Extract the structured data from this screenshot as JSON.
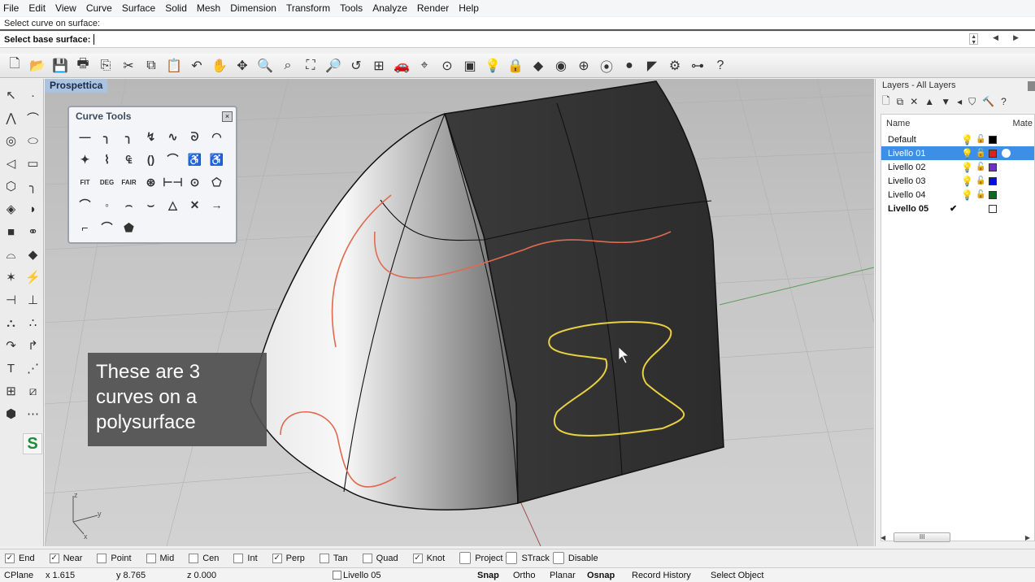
{
  "menu": [
    "File",
    "Edit",
    "View",
    "Curve",
    "Surface",
    "Solid",
    "Mesh",
    "Dimension",
    "Transform",
    "Tools",
    "Analyze",
    "Render",
    "Help"
  ],
  "command": {
    "history": "Select curve on surface:",
    "prompt": "Select base surface:"
  },
  "toolbar": {
    "icons": [
      {
        "name": "new-icon",
        "glyph": "🗋"
      },
      {
        "name": "open-icon",
        "glyph": "📂"
      },
      {
        "name": "save-icon",
        "glyph": "💾"
      },
      {
        "name": "print-icon",
        "glyph": "🖶"
      },
      {
        "name": "export-icon",
        "glyph": "⎘"
      },
      {
        "name": "cut-icon",
        "glyph": "✂"
      },
      {
        "name": "copy-icon",
        "glyph": "⧉"
      },
      {
        "name": "paste-icon",
        "glyph": "📋"
      },
      {
        "name": "undo-icon",
        "glyph": "↶"
      },
      {
        "name": "pan-icon",
        "glyph": "✋"
      },
      {
        "name": "rotate-view-icon",
        "glyph": "✥"
      },
      {
        "name": "zoom-icon",
        "glyph": "🔍"
      },
      {
        "name": "zoom-window-icon",
        "glyph": "⌕"
      },
      {
        "name": "zoom-extents-icon",
        "glyph": "⛶"
      },
      {
        "name": "zoom-selected-icon",
        "glyph": "🔎"
      },
      {
        "name": "undo-view-icon",
        "glyph": "↺"
      },
      {
        "name": "four-viewports-icon",
        "glyph": "⊞"
      },
      {
        "name": "car-icon",
        "glyph": "🚗"
      },
      {
        "name": "grid-snap-icon",
        "glyph": "⌖"
      },
      {
        "name": "point-filter-icon",
        "glyph": "⊙"
      },
      {
        "name": "select-objects-icon",
        "glyph": "▣"
      },
      {
        "name": "light-bulb-icon",
        "glyph": "💡"
      },
      {
        "name": "lock-icon",
        "glyph": "🔒"
      },
      {
        "name": "layer-icon",
        "glyph": "◆"
      },
      {
        "name": "color-wheel-icon",
        "glyph": "◉"
      },
      {
        "name": "wireframe-sphere-icon",
        "glyph": "⊕"
      },
      {
        "name": "shaded-sphere-icon",
        "glyph": "⦿"
      },
      {
        "name": "rendered-sphere-icon",
        "glyph": "●"
      },
      {
        "name": "render-flag-icon",
        "glyph": "◤"
      },
      {
        "name": "options-gear-icon",
        "glyph": "⚙"
      },
      {
        "name": "hierarchy-icon",
        "glyph": "⊶"
      },
      {
        "name": "help-icon",
        "glyph": "?"
      }
    ]
  },
  "left_tools": [
    {
      "name": "select-arrow-icon",
      "glyph": "↖"
    },
    {
      "name": "point-icon",
      "glyph": "·"
    },
    {
      "name": "polyline-icon",
      "glyph": "⋀"
    },
    {
      "name": "curve-icon",
      "glyph": "⌒"
    },
    {
      "name": "circle-icon",
      "glyph": "◎"
    },
    {
      "name": "ellipse-icon",
      "glyph": "⬭"
    },
    {
      "name": "arc-icon",
      "glyph": "◁"
    },
    {
      "name": "rectangle-icon",
      "glyph": "▭"
    },
    {
      "name": "polygon-icon",
      "glyph": "⬡"
    },
    {
      "name": "fillet-curve-icon",
      "glyph": "╮"
    },
    {
      "name": "surface-corner-icon",
      "glyph": "◈"
    },
    {
      "name": "surface-loft-icon",
      "glyph": "◗"
    },
    {
      "name": "box-icon",
      "glyph": "■"
    },
    {
      "name": "boolean-icon",
      "glyph": "⚭"
    },
    {
      "name": "cylinder-icon",
      "glyph": "⌓"
    },
    {
      "name": "mesh-icon",
      "glyph": "◆"
    },
    {
      "name": "explode-icon",
      "glyph": "✶"
    },
    {
      "name": "split-icon",
      "glyph": "⚡"
    },
    {
      "name": "trim-icon",
      "glyph": "⊣"
    },
    {
      "name": "split-curve-icon",
      "glyph": "⊥"
    },
    {
      "name": "group-icon",
      "glyph": "⛬"
    },
    {
      "name": "ungroup-icon",
      "glyph": "∴"
    },
    {
      "name": "move-icon",
      "glyph": "↷"
    },
    {
      "name": "transform-icon",
      "glyph": "↱"
    },
    {
      "name": "text-icon",
      "glyph": "T"
    },
    {
      "name": "dimension-icon",
      "glyph": "⋰"
    },
    {
      "name": "array-icon",
      "glyph": "⊞"
    },
    {
      "name": "block-icon",
      "glyph": "⧄"
    },
    {
      "name": "solid-tools-icon",
      "glyph": "⬢"
    },
    {
      "name": "analyze-icon",
      "glyph": "⋯"
    }
  ],
  "left_tools_extra": {
    "name": "s-plugin-icon",
    "label": "S"
  },
  "viewport": {
    "title": "Prospettica",
    "axis_labels": {
      "z": "z",
      "y": "y",
      "x": "x"
    }
  },
  "curve_tools": {
    "title": "Curve Tools",
    "rows": [
      [
        "—",
        "╮",
        "╮",
        "↯",
        "∿",
        "ᘐ",
        "◠"
      ],
      [
        "✦",
        "⌇",
        "₠",
        "()",
        "⌒",
        "♿",
        "♿"
      ],
      [
        "FIT",
        "DEG",
        "FAIR",
        "⊛",
        "⊢⊣",
        "⊙",
        "⬠"
      ],
      [
        "⌒",
        "◦",
        "⌢",
        "⌣",
        "△",
        "✕",
        "→"
      ],
      [
        "⌐",
        "⌒",
        "⬟"
      ]
    ]
  },
  "caption": "These are 3 curves on a polysurface",
  "layers": {
    "title": "Layers - All Layers",
    "toolbar": [
      "🗋",
      "⧉",
      "✕",
      "▲",
      "▼",
      "◂",
      "⛉",
      "🔨",
      "?"
    ],
    "columns": {
      "name": "Name",
      "material": "Mate"
    },
    "rows": [
      {
        "name": "Default",
        "color": "#000000",
        "selected": false,
        "current": false,
        "visible": true,
        "locked": false
      },
      {
        "name": "Livello 01",
        "color": "#e02020",
        "selected": true,
        "current": false,
        "visible": true,
        "locked": false
      },
      {
        "name": "Livello 02",
        "color": "#7030c0",
        "selected": false,
        "current": false,
        "visible": true,
        "locked": false
      },
      {
        "name": "Livello 03",
        "color": "#0010e0",
        "selected": false,
        "current": false,
        "visible": true,
        "locked": false
      },
      {
        "name": "Livello 04",
        "color": "#0a6a20",
        "selected": false,
        "current": false,
        "visible": true,
        "locked": false
      },
      {
        "name": "Livello 05",
        "color": "#ffffff",
        "selected": false,
        "current": true,
        "visible": null,
        "locked": null
      }
    ],
    "check_glyph": "✔",
    "bulb_glyph": "💡",
    "lock_glyph": "🔓",
    "scroll_thumb": "III"
  },
  "osnap": [
    {
      "label": "End",
      "checked": true
    },
    {
      "label": "Near",
      "checked": true
    },
    {
      "label": "Point",
      "checked": false
    },
    {
      "label": "Mid",
      "checked": false
    },
    {
      "label": "Cen",
      "checked": false
    },
    {
      "label": "Int",
      "checked": false
    },
    {
      "label": "Perp",
      "checked": true
    },
    {
      "label": "Tan",
      "checked": false
    },
    {
      "label": "Quad",
      "checked": false
    },
    {
      "label": "Knot",
      "checked": true
    }
  ],
  "osnap_extra": [
    {
      "label": "Project",
      "checked": false
    },
    {
      "label": "STrack",
      "checked": false
    },
    {
      "label": "Disable",
      "checked": false
    }
  ],
  "status": {
    "cplane": "CPlane",
    "x": "x 1.615",
    "y": "y 8.765",
    "z": "z 0.000",
    "layer": "Livello 05",
    "snap": "Snap",
    "ortho": "Ortho",
    "planar": "Planar",
    "osnap": "Osnap",
    "record_history": "Record History",
    "select_object": "Select Object"
  },
  "colors": {
    "curve_red": "#e06a50",
    "curve_yellow": "#e8d040",
    "selection_blue": "#3d8ee6",
    "viewport_title_bg": "#a9c3e0"
  }
}
